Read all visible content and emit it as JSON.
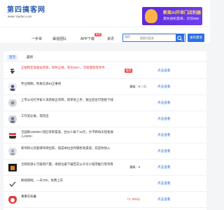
{
  "header": {
    "logo_text": "第四搞客网",
    "logo_url": "www.Yjedon.com",
    "banner_line1": "新商AI开单门店利器",
    "banner_line2": "莫失良机首单，仅仅888"
  },
  "nav": {
    "items": [
      "一手单",
      "渠道团队",
      "APP下载",
      "资讯"
    ],
    "app_badge": "免费"
  },
  "search": {
    "category": "项目",
    "placeholder": "搜索内容关",
    "publish_label": "发布需求"
  },
  "tabs": [
    "首页",
    "最新"
  ],
  "rows": [
    {
      "text": "正规稳定高收益项目，绿色正规，单天500+，可批量放等单件",
      "red": true,
      "tag": "推荐",
      "mid": "",
      "status": "",
      "link": "点击查看"
    },
    {
      "text": "专业揭佣，秒质信息纠正事修",
      "red": false,
      "tag": "",
      "mid": "量级：6",
      "status": "已截",
      "link": "点击查看"
    },
    {
      "text": "上市公司打手家人消息秘五项目，简单易上手，独立后台可直接下线",
      "red": false,
      "tag": "",
      "mid": "",
      "status": "",
      "link": "点击查看"
    },
    {
      "text": "工作室必备，现货出",
      "red": false,
      "tag": "",
      "mid": "",
      "status": "",
      "link": "点击查看"
    },
    {
      "text": "全国限100000+测信项目渠道，合伙人每个10元，大不断每天轻松收入1000+",
      "red": false,
      "tag": "",
      "mid": "",
      "status": "",
      "link": "点击查看"
    },
    {
      "text": "新项目火热套够项目拉新，低成本拉台时钢各地渠道，欢迎你加入",
      "red": false,
      "tag": "",
      "mid": "",
      "status": "",
      "link": "点击查看"
    },
    {
      "text": "全网资源十万级用户量，承接注册下载百实公众号小程序推行等项目",
      "red": false,
      "tag": "",
      "mid": "量级：5",
      "status": "",
      "link": "点击查看"
    },
    {
      "text": "刷视频网，一天700，免费上车",
      "red": false,
      "tag": "",
      "mid": "",
      "status": "",
      "link": "点击查看"
    },
    {
      "text": "惠惠车机戴",
      "red": false,
      "tag": "",
      "mid": "T1: 600元",
      "status": "",
      "link": "点击查看"
    }
  ],
  "colors": {
    "accent": "#2d6fe0",
    "alert": "#e03a3a",
    "banner": "#5b2bd9"
  },
  "icons": [
    "search-icon"
  ]
}
